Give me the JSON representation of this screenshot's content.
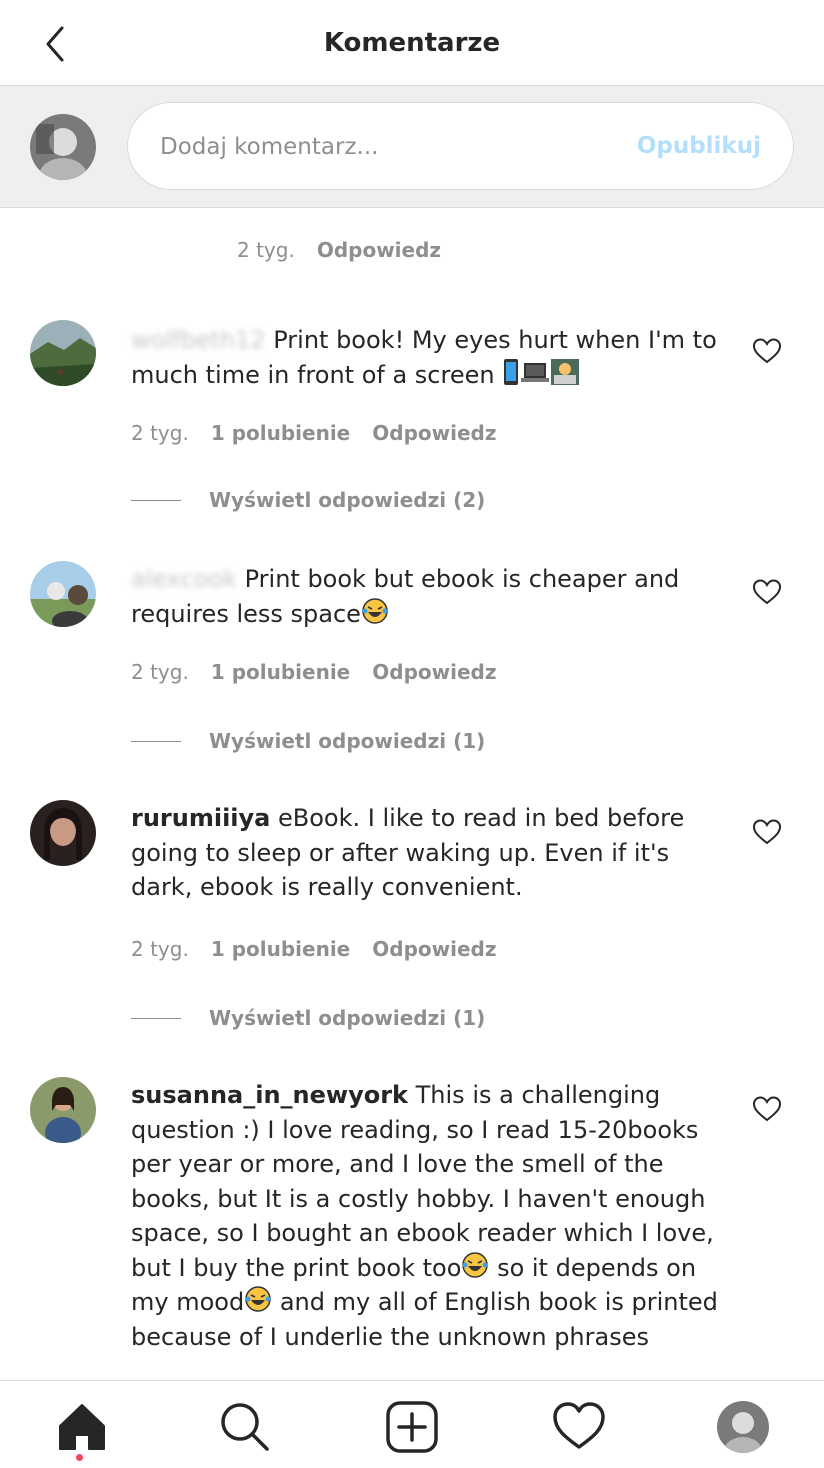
{
  "header": {
    "title": "Komentarze",
    "back_icon": "chevron-left-icon"
  },
  "compose": {
    "placeholder": "Dodaj komentarz...",
    "publish_label": "Opublikuj",
    "publish_color": "#b2dffc"
  },
  "top_meta": {
    "time": "2 tyg.",
    "reply": "Odpowiedz"
  },
  "comments": [
    {
      "username": "wolfbeth12",
      "text": "Print book! My eyes hurt when I'm to much time in front of a screen",
      "emojis": [
        "mobile-phone-icon",
        "laptop-icon",
        "person-at-laptop-icon"
      ],
      "time": "2 tyg.",
      "likes": "1 polubienie",
      "reply": "Odpowiedz",
      "view_replies": "Wyświetl odpowiedzi (2)"
    },
    {
      "username": "alexcook",
      "text": "Print book but ebook is cheaper and requires less space",
      "emojis": [
        "laughing-tears-icon"
      ],
      "time": "2 tyg.",
      "likes": "1 polubienie",
      "reply": "Odpowiedz",
      "view_replies": "Wyświetl odpowiedzi (1)"
    },
    {
      "username": "rurumiiiya",
      "text": "eBook. I like to read in bed before going to sleep or after waking up. Even if it's dark, ebook is really convenient.",
      "time": "2 tyg.",
      "likes": "1 polubienie",
      "reply": "Odpowiedz",
      "view_replies": "Wyświetl odpowiedzi (1)"
    },
    {
      "username": "susanna_in_newyork",
      "text_part1": "This is a challenging question :) I love reading, so I read 15-20books per year or more, and I love the smell of the books, but It is a costly hobby. I haven't enough space, so I bought an ebook reader which I love, but I buy the print book too",
      "text_part2": "so it depends on my mood",
      "text_part3": "and my all of English book is printed because of I underlie the unknown phrases",
      "emojis": [
        "laughing-tears-icon",
        "laughing-tears-icon"
      ]
    }
  ],
  "navbar": {
    "items": [
      "home-icon",
      "search-icon",
      "add-post-icon",
      "activity-heart-icon",
      "profile-avatar"
    ],
    "notification_dot_color": "#ed4956"
  }
}
